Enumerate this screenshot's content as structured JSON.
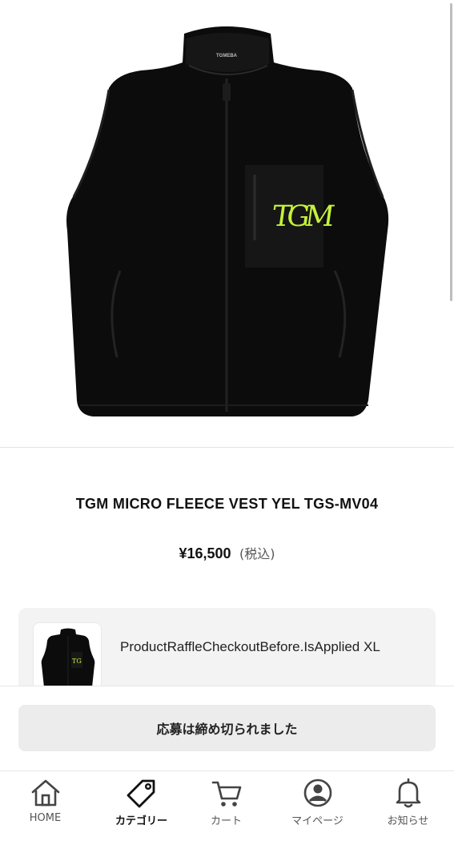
{
  "product": {
    "title": "TGM MICRO FLEECE VEST YEL TGS-MV04",
    "price": "¥16,500",
    "tax_note": "(税込)",
    "image_alt": "black micro fleece vest with yellow TGM logo on chest pocket",
    "logo_text": "TGM",
    "neck_label": "TGMEBA",
    "colors": {
      "garment": "#0c0c0c",
      "logo": "#c5f23a"
    }
  },
  "raffle": {
    "text": "ProductRaffleCheckoutBefore.IsApplied XL"
  },
  "action": {
    "closed_label": "応募は締め切られました"
  },
  "tabbar": {
    "items": [
      {
        "label": "HOME",
        "icon": "home-icon",
        "active": false
      },
      {
        "label": "カテゴリー",
        "icon": "tag-icon",
        "active": true
      },
      {
        "label": "カート",
        "icon": "cart-icon",
        "active": false
      },
      {
        "label": "マイページ",
        "icon": "user-icon",
        "active": false
      },
      {
        "label": "お知らせ",
        "icon": "bell-icon",
        "active": false
      }
    ]
  }
}
